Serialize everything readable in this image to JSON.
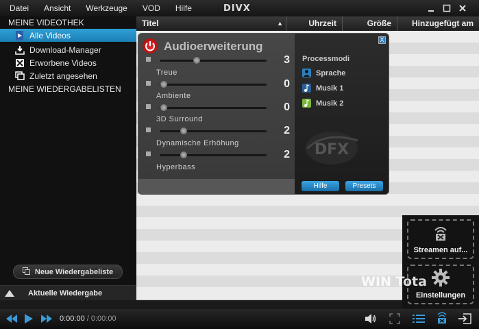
{
  "menu": [
    "Datei",
    "Ansicht",
    "Werkzeuge",
    "VOD",
    "Hilfe"
  ],
  "logo": "DIVX",
  "window_controls": [
    "minimize-icon",
    "maximize-icon",
    "close-icon"
  ],
  "sidebar": {
    "library_header": "MEINE VIDEOTHEK",
    "items": [
      {
        "label": "Alle Videos",
        "icon": "video-file-icon",
        "active": true
      },
      {
        "label": "Download-Manager",
        "icon": "download-icon",
        "active": false
      },
      {
        "label": "Erworbene Videos",
        "icon": "purchased-icon",
        "active": false
      },
      {
        "label": "Zuletzt angesehen",
        "icon": "recent-icon",
        "active": false
      }
    ],
    "playlists_header": "MEINE WIEDERGABELISTEN",
    "new_playlist_label": "Neue Wiedergabeliste",
    "current_playback_label": "Aktuelle Wiedergabe"
  },
  "table": {
    "columns": [
      "Titel",
      "Uhrzeit",
      "Größe",
      "Hinzugefügt am"
    ],
    "sort_indicator": "▲"
  },
  "audio_panel": {
    "title": "Audioerweiterung",
    "sliders": [
      {
        "label": "Treue",
        "value": "3",
        "level": 0.33
      },
      {
        "label": "Ambiente",
        "value": "0",
        "level": 0.0
      },
      {
        "label": "3D Surround",
        "value": "0",
        "level": 0.0
      },
      {
        "label": "Dynamische Erhöhung",
        "value": "2",
        "level": 0.2
      },
      {
        "label": "Hyperbass",
        "value": "2",
        "level": 0.2
      }
    ],
    "process_modes_title": "Processmodi",
    "modes": [
      {
        "label": "Sprache",
        "icon": "speech-icon",
        "color": "#2a7fc0"
      },
      {
        "label": "Musik 1",
        "icon": "music-note-icon",
        "color": "#2a5f9a"
      },
      {
        "label": "Musik 2",
        "icon": "music-note-green-icon",
        "color": "#7ab83a"
      }
    ],
    "logo": "DFX",
    "help_label": "Hilfe",
    "presets_label": "Presets",
    "close_label": "X"
  },
  "side_buttons": {
    "stream_label": "Streamen auf...",
    "settings_label": "Einstellungen"
  },
  "watermark": "WIN Tota",
  "player": {
    "time_current": "0:00:00",
    "time_separator": " / ",
    "time_total": "0:00:00"
  },
  "colors": {
    "accent": "#2190cc",
    "background": "#1a1a1a"
  }
}
